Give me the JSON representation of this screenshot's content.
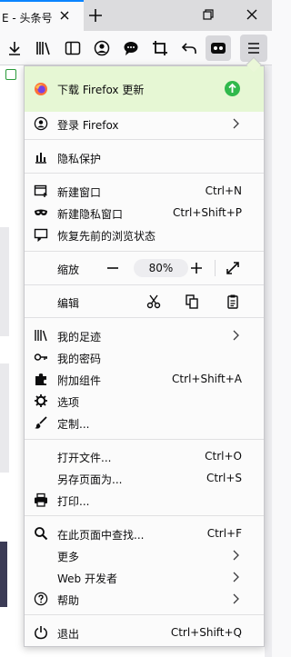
{
  "tab": {
    "title": "E - 头条号"
  },
  "panel": {
    "update": {
      "label": "下载 Firefox 更新"
    },
    "signin": {
      "label": "登录 Firefox"
    },
    "privacy": {
      "label": "隐私保护"
    },
    "new_window": {
      "label": "新建窗口",
      "shortcut": "Ctrl+N"
    },
    "private_window": {
      "label": "新建隐私窗口",
      "shortcut": "Ctrl+Shift+P"
    },
    "restore": {
      "label": "恢复先前的浏览状态"
    },
    "zoom": {
      "label": "缩放",
      "value": "80%"
    },
    "edit": {
      "label": "编辑"
    },
    "library": {
      "label": "我的足迹"
    },
    "logins": {
      "label": "我的密码"
    },
    "addons": {
      "label": "附加组件",
      "shortcut": "Ctrl+Shift+A"
    },
    "options": {
      "label": "选项"
    },
    "customize": {
      "label": "定制..."
    },
    "open_file": {
      "label": "打开文件...",
      "shortcut": "Ctrl+O"
    },
    "save_page": {
      "label": "另存页面为...",
      "shortcut": "Ctrl+S"
    },
    "print": {
      "label": "打印..."
    },
    "find": {
      "label": "在此页面中查找...",
      "shortcut": "Ctrl+F"
    },
    "more": {
      "label": "更多"
    },
    "web_dev": {
      "label": "Web 开发者"
    },
    "help": {
      "label": "帮助"
    },
    "quit": {
      "label": "退出",
      "shortcut": "Ctrl+Shift+Q"
    }
  },
  "colors": {
    "accent": "#0a84ff",
    "update_bg": "#e6f7d4",
    "update_badge": "#30b94c"
  }
}
